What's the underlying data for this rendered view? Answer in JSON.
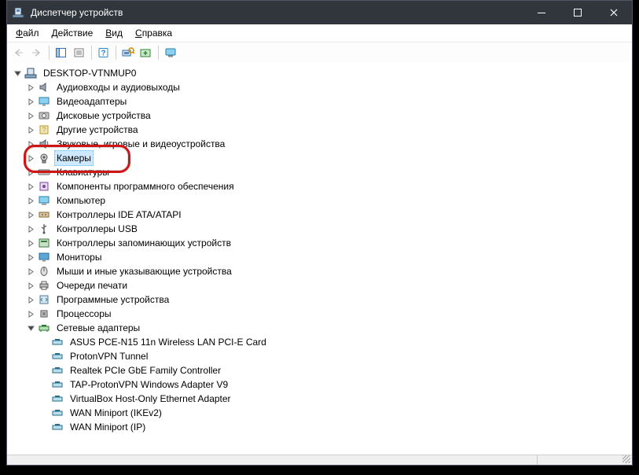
{
  "title": "Диспетчер устройств",
  "menu": {
    "file": "Файл",
    "action": "Действие",
    "view": "Вид",
    "help": "Справка"
  },
  "root": "DESKTOP-VTNMUP0",
  "categories": [
    {
      "label": "Аудиовходы и аудиовыходы",
      "icon": "audio"
    },
    {
      "label": "Видеоадаптеры",
      "icon": "display"
    },
    {
      "label": "Дисковые устройства",
      "icon": "disk"
    },
    {
      "label": "Другие устройства",
      "icon": "other"
    },
    {
      "label": "Звуковые, игровые и видеоустройства",
      "icon": "sound"
    },
    {
      "label": "Камеры",
      "icon": "camera",
      "selected": true
    },
    {
      "label": "Клавиатуры",
      "icon": "keyboard"
    },
    {
      "label": "Компоненты программного обеспечения",
      "icon": "software"
    },
    {
      "label": "Компьютер",
      "icon": "computer"
    },
    {
      "label": "Контроллеры IDE ATA/ATAPI",
      "icon": "ide"
    },
    {
      "label": "Контроллеры USB",
      "icon": "usb"
    },
    {
      "label": "Контроллеры запоминающих устройств",
      "icon": "storage"
    },
    {
      "label": "Мониторы",
      "icon": "monitor"
    },
    {
      "label": "Мыши и иные указывающие устройства",
      "icon": "mouse"
    },
    {
      "label": "Очереди печати",
      "icon": "print"
    },
    {
      "label": "Программные устройства",
      "icon": "softdev"
    },
    {
      "label": "Процессоры",
      "icon": "cpu"
    },
    {
      "label": "Сетевые адаптеры",
      "icon": "net",
      "expanded": true,
      "children": [
        "ASUS PCE-N15 11n Wireless LAN PCI-E Card",
        "ProtonVPN Tunnel",
        "Realtek PCIe GbE Family Controller",
        "TAP-ProtonVPN Windows Adapter V9",
        "VirtualBox Host-Only Ethernet Adapter",
        "WAN Miniport (IKEv2)",
        "WAN Miniport (IP)"
      ]
    }
  ],
  "highlighted_index": 5
}
